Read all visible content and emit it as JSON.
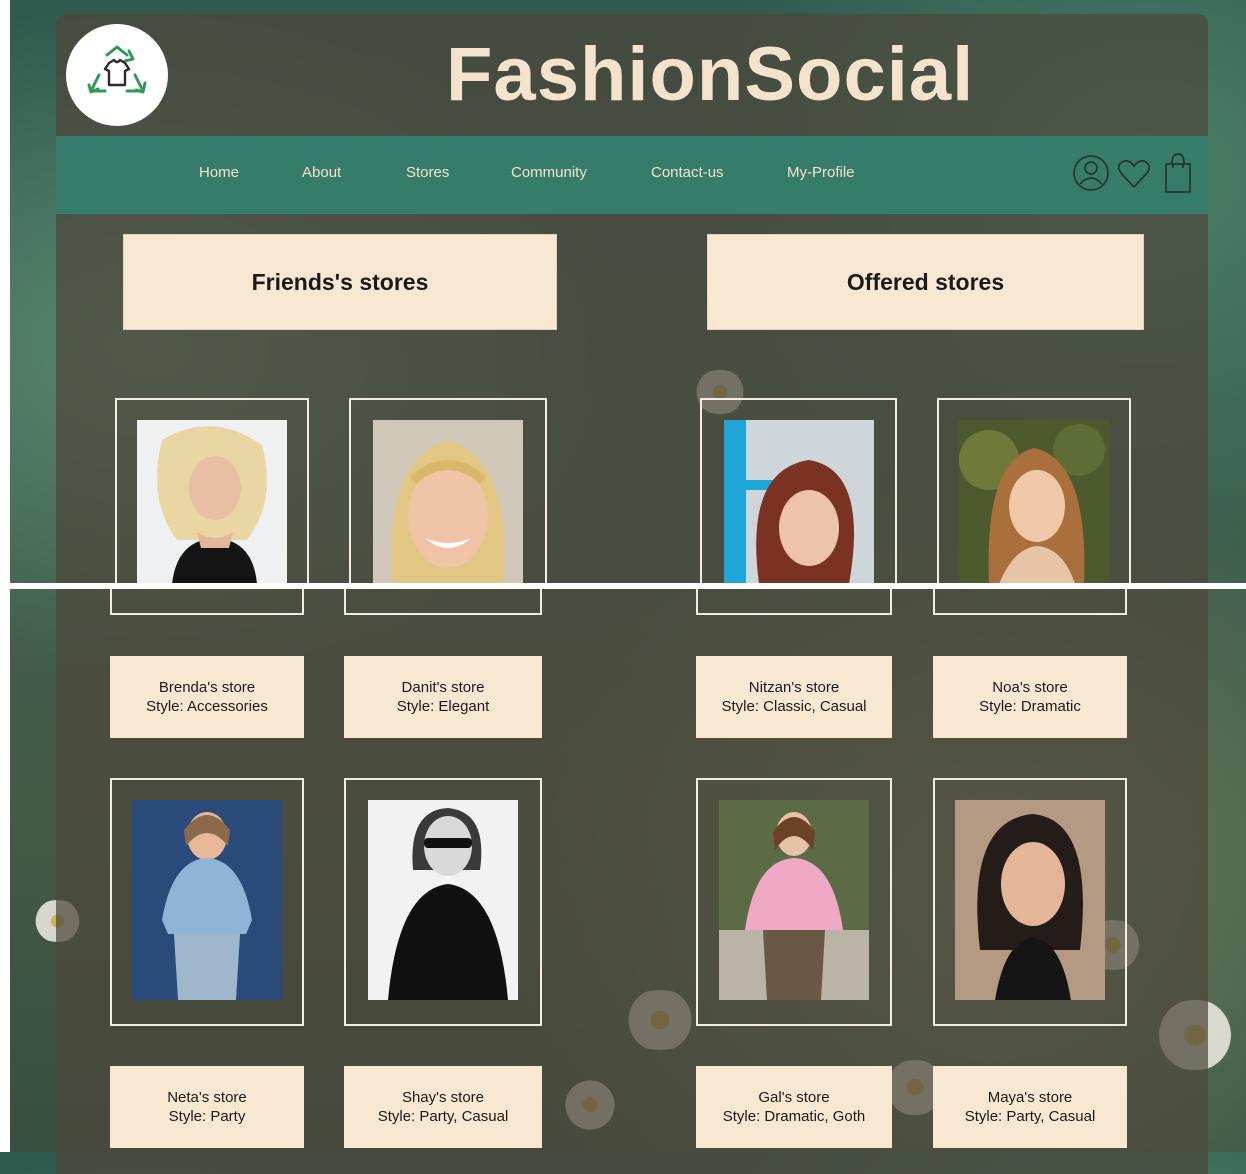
{
  "brand": {
    "title": "FashionSocial",
    "logo_icon": "recycle-shirt-icon"
  },
  "nav": {
    "items": [
      "Home",
      "About",
      "Stores",
      "Community",
      "Contact-us",
      "My-Profile"
    ],
    "icons": [
      "user-icon",
      "heart-icon",
      "shopping-bag-icon"
    ]
  },
  "sections": {
    "friends_title": "Friends's stores",
    "offered_title": "Offered stores"
  },
  "stores": [
    {
      "name": "Brenda's store",
      "style": "Style: Accessories",
      "group": "friends"
    },
    {
      "name": "Danit's store",
      "style": "Style: Elegant",
      "group": "friends"
    },
    {
      "name": "Nitzan's store",
      "style": "Style: Classic, Casual",
      "group": "offered"
    },
    {
      "name": "Noa's store",
      "style": "Style: Dramatic",
      "group": "offered"
    },
    {
      "name": "Neta's store",
      "style": "Style: Party",
      "group": "friends"
    },
    {
      "name": "Shay's store",
      "style": "Style: Party, Casual",
      "group": "friends"
    },
    {
      "name": "Gal's store",
      "style": "Style: Dramatic, Goth",
      "group": "offered"
    },
    {
      "name": "Maya's store",
      "style": "Style: Party, Casual",
      "group": "offered"
    }
  ],
  "colors": {
    "accent": "#357c6a",
    "card": "#f8e7d1",
    "brand_text": "#f4e3cc"
  }
}
